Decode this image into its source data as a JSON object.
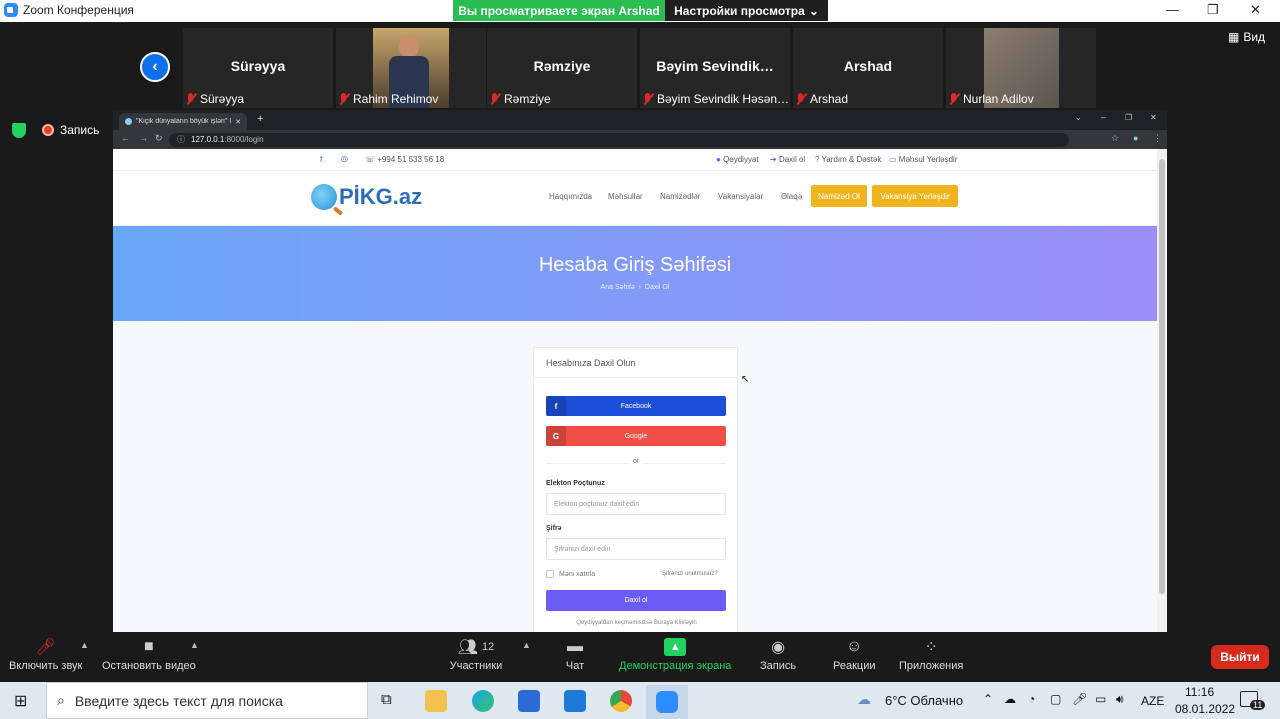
{
  "window": {
    "title": "Zoom Конференция"
  },
  "share_banner": {
    "viewing": "Вы просматриваете экран Arshad",
    "settings": "Настройки просмотра"
  },
  "gallery": [
    {
      "big": "Sürəyya",
      "label": "Sürəyya",
      "video": false
    },
    {
      "big": "",
      "label": "Rahim Rehimov",
      "video": true
    },
    {
      "big": "Rəmziye",
      "label": "Rəmziye",
      "video": false
    },
    {
      "big": "Bəyim  Sevindik…",
      "label": "Bəyim Sevindik Həsən…",
      "video": false
    },
    {
      "big": "Arshad",
      "label": "Arshad",
      "video": false
    },
    {
      "big": "",
      "label": "Nurlan Adilov",
      "video": true
    }
  ],
  "view_button": "Вид",
  "recording_label": "Запись",
  "browser": {
    "tab_title": "\"Kiçik dünyaların böyük işləri\" İş…",
    "url_host": "127.0.0.1",
    "url_path": ":8000/login",
    "topbar": {
      "phone": "+994 51 533 56 18",
      "links": [
        "Qeydiyyat",
        "Daxil ol",
        "Yardım & Dəstək",
        "Məhsul Yerləşdir"
      ]
    },
    "nav": {
      "logo": "PİKG.az",
      "links": [
        "Haqqımızda",
        "Məhsullar",
        "Namizədlər",
        "Vakansiyalar",
        "Əlaqə"
      ],
      "btn1": "Namizəd Ol",
      "btn2": "Vakansiya Yerləşdir"
    },
    "hero": {
      "title": "Hesaba Giriş Səhifəsi",
      "crumb_home": "Ana Səhifə",
      "crumb_current": "Daxil Ol"
    },
    "login": {
      "heading": "Hesabınıza Daxil Olun",
      "facebook": "Facebook",
      "google": "Google",
      "or": "or",
      "email_label": "Elekton Poçtunuz",
      "email_placeholder": "Elekton poçtunuz daxil edin",
      "password_label": "Şifrə",
      "password_placeholder": "Şifrənizi daxil edin",
      "remember": "Məni xatırla",
      "forgot": "Şifrənizi unutmusuz?",
      "submit": "Daxil ol",
      "register": "Qeydiyyatdan keçməmisizsə Buraya Klikləyin"
    }
  },
  "toolbar": {
    "audio": "Включить звук",
    "video": "Остановить видео",
    "participants": "Участники",
    "participants_count": "12",
    "chat": "Чат",
    "share": "Демонстрация экрана",
    "record": "Запись",
    "reactions": "Реакции",
    "apps": "Приложения",
    "leave": "Выйти"
  },
  "taskbar": {
    "search_placeholder": "Введите здесь текст для поиска",
    "weather": "6°C  Облачно",
    "lang": "AZE",
    "time": "11:16",
    "date": "08.01.2022",
    "notif": "11"
  },
  "colors": {
    "share_green": "#2bbd52",
    "leave_red": "#d52b1e",
    "facebook": "#1d4ed8",
    "google": "#ef4f45",
    "submit": "#6a5cf6",
    "accent": "#f0b41e"
  }
}
